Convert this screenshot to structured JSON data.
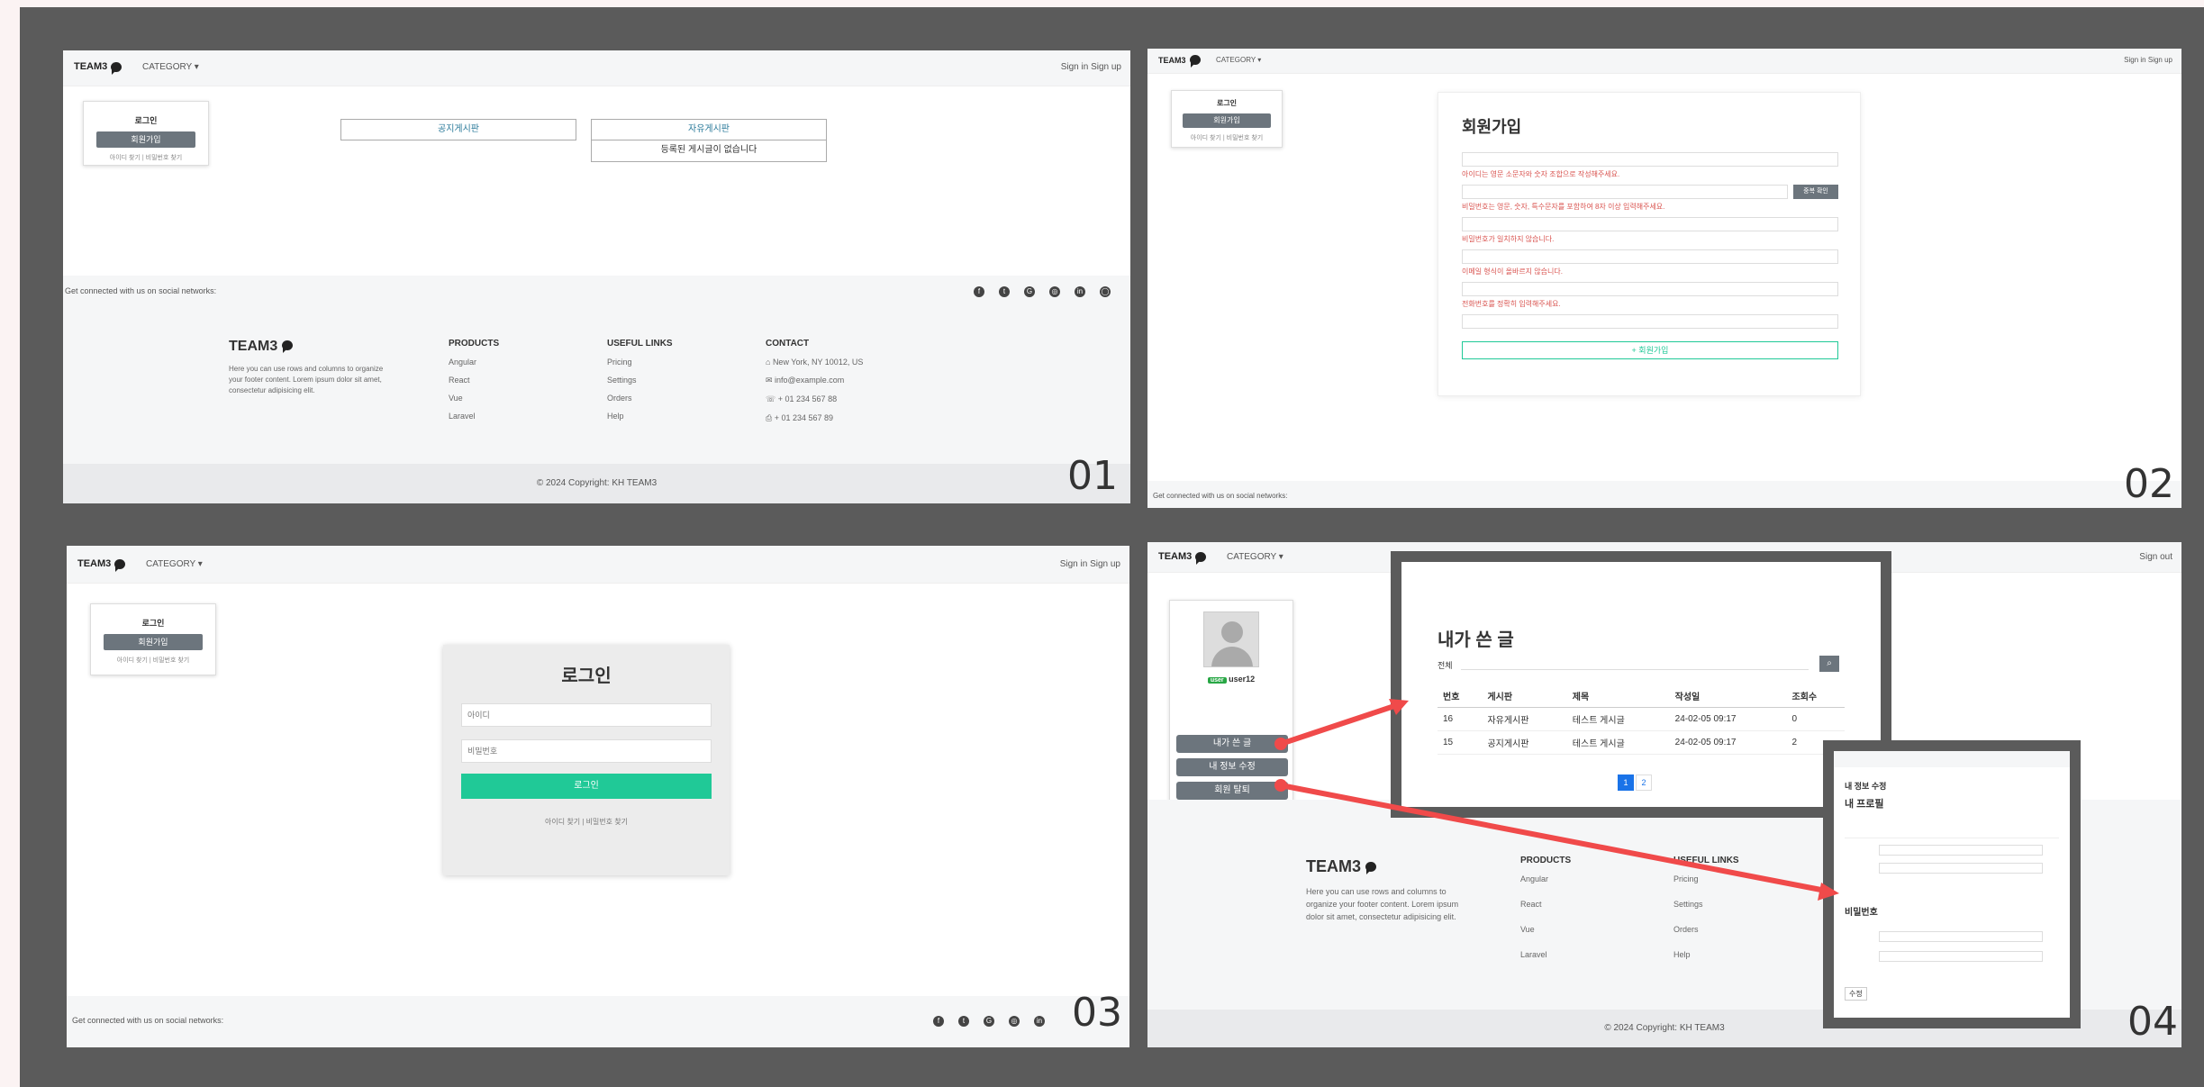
{
  "nav": {
    "brand": "TEAM3",
    "category": "CATEGORY ▾",
    "auth": "Sign in  Sign up",
    "auth_single": "Sign out"
  },
  "sidebar": {
    "title": "로그인",
    "button": "회원가입",
    "links": "아이디 찾기 | 비밀번호 찾기"
  },
  "panel1": {
    "number": "01",
    "boards": [
      {
        "label": "공지게시판"
      },
      {
        "label": "자유게시판",
        "note": "등록된 게시글이 없습니다"
      }
    ],
    "social_text": "Get connected with us on social networks:",
    "footer": {
      "brand": "TEAM3",
      "desc": "Here you can use rows and columns to organize your footer content. Lorem ipsum dolor sit amet, consectetur adipisicing elit.",
      "products_title": "PRODUCTS",
      "products": [
        "Angular",
        "React",
        "Vue",
        "Laravel"
      ],
      "links_title": "USEFUL LINKS",
      "links": [
        "Pricing",
        "Settings",
        "Orders",
        "Help"
      ],
      "contact_title": "CONTACT",
      "contact": [
        "New York, NY 10012, US",
        "info@example.com",
        "+ 01 234 567 88",
        "+ 01 234 567 89"
      ]
    },
    "copyright": "© 2024 Copyright: KH TEAM3"
  },
  "panel2": {
    "number": "02",
    "title": "회원가입",
    "check_button": "중복 확인",
    "errors": [
      "아이디는 영문 소문자와 숫자 조합으로 작성해주세요.",
      "비밀번호는 영문, 숫자, 특수문자를 포함하여 8자 이상 입력해주세요.",
      "비밀번호가 일치하지 않습니다.",
      "이메일 형식이 올바르지 않습니다.",
      "전화번호를 정확히 입력해주세요."
    ],
    "submit": "+ 회원가입"
  },
  "panel3": {
    "number": "03",
    "title": "로그인",
    "id_placeholder": "아이디",
    "pw_placeholder": "비밀번호",
    "login_button": "로그인",
    "links": "아이디 찾기 | 비밀번호 찾기",
    "social_text": "Get connected with us on social networks:"
  },
  "panel4": {
    "number": "04",
    "badge": "user",
    "username": "user12",
    "menu": [
      "내가 쓴 글",
      "내 정보 수정",
      "회원 탈퇴"
    ],
    "popup1": {
      "title": "내가 쓴 글",
      "select": "전체",
      "columns": [
        "번호",
        "게시판",
        "제목",
        "작성일",
        "조회수"
      ],
      "rows": [
        [
          "16",
          "자유게시판",
          "테스트 게시글",
          "24-02-05 09:17",
          "0"
        ],
        [
          "15",
          "공지게시판",
          "테스트 게시글",
          "24-02-05 09:17",
          "2"
        ]
      ],
      "pages": [
        "1",
        "2"
      ]
    },
    "popup2": {
      "title": "내 정보 수정",
      "section": "내 프로필",
      "section2": "비밀번호",
      "button": "수정"
    },
    "footer_brand": "TEAM3",
    "copyright": "© 2024 Copyright: KH TEAM3"
  },
  "colors": {
    "frame": "#5b5b5b",
    "accent": "#20c997",
    "arrow": "#f04a4a",
    "error": "#d9534f"
  }
}
